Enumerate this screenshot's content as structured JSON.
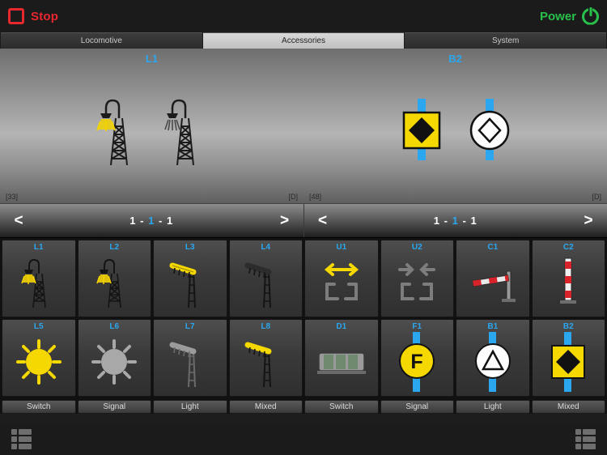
{
  "topbar": {
    "stop_label": "Stop",
    "power_label": "Power",
    "stop_color": "#e8272e",
    "power_color": "#27c04a"
  },
  "tabs": [
    {
      "label": "Locomotive",
      "active": false
    },
    {
      "label": "Accessories",
      "active": true
    },
    {
      "label": "System",
      "active": false
    }
  ],
  "display": {
    "left": {
      "title": "L1",
      "corner_left": "[33]",
      "corner_right": "[D]"
    },
    "right": {
      "title": "B2",
      "corner_left": "[48]",
      "corner_right": "[D]"
    }
  },
  "nav": {
    "left": {
      "prev": "<",
      "next": ">",
      "digits": [
        "1",
        "-",
        "1",
        "-",
        "1"
      ],
      "highlight_index": 2
    },
    "right": {
      "prev": "<",
      "next": ">",
      "digits": [
        "1",
        "-",
        "1",
        "-",
        "1"
      ],
      "highlight_index": 2
    }
  },
  "grid": {
    "row1": [
      {
        "label": "L1",
        "icon": "street-lamp-lit-icon"
      },
      {
        "label": "L2",
        "icon": "street-lamp-lit-icon"
      },
      {
        "label": "L3",
        "icon": "street-lamp-yellow-icon"
      },
      {
        "label": "L4",
        "icon": "street-lamp-dark-icon"
      },
      {
        "label": "U1",
        "icon": "double-arrow-icon"
      },
      {
        "label": "U2",
        "icon": "converge-arrow-icon"
      },
      {
        "label": "C1",
        "icon": "crossing-gate-icon"
      },
      {
        "label": "C2",
        "icon": "barrier-post-icon"
      }
    ],
    "row2": [
      {
        "label": "L5",
        "icon": "sun-lamp-on-icon"
      },
      {
        "label": "L6",
        "icon": "sun-lamp-off-icon"
      },
      {
        "label": "L7",
        "icon": "lamp-pole-grey-icon"
      },
      {
        "label": "L8",
        "icon": "lamp-arm-yellow-icon"
      },
      {
        "label": "D1",
        "icon": "turntable-icon"
      },
      {
        "label": "F1",
        "icon": "yellow-f-sign-icon"
      },
      {
        "label": "B1",
        "icon": "white-triangle-sign-icon"
      },
      {
        "label": "B2",
        "icon": "yellow-diamond-sign-icon"
      }
    ],
    "footer": [
      "Switch",
      "Signal",
      "Light",
      "Mixed",
      "Switch",
      "Signal",
      "Light",
      "Mixed"
    ]
  },
  "bottombar": {
    "left_icon": "grid-list-icon",
    "right_icon": "grid-list-icon"
  },
  "colors": {
    "accent_blue": "#2aa7ef",
    "sign_yellow": "#f5d800",
    "stop_red": "#e8272e",
    "power_green": "#27c04a"
  }
}
